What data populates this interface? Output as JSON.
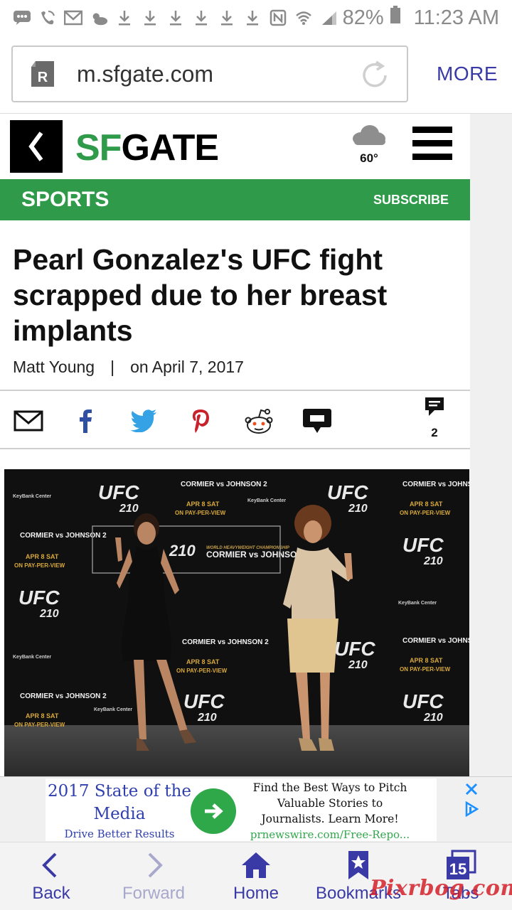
{
  "status_bar": {
    "battery": "82%",
    "time": "11:23 AM"
  },
  "browser": {
    "url": "m.sfgate.com",
    "more_label": "MORE"
  },
  "site": {
    "logo_sf": "SF",
    "logo_gate": "GATE",
    "weather_temp": "60°",
    "section": "SPORTS",
    "subscribe": "SUBSCRIBE",
    "brand_color": "#2f9a49"
  },
  "article": {
    "headline": "Pearl Gonzalez's UFC fight scrapped due to her breast implants",
    "author": "Matt Young",
    "separator": "|",
    "date": "on April 7, 2017",
    "comment_count": "2"
  },
  "share_icons": [
    "email-icon",
    "facebook-icon",
    "twitter-icon",
    "pinterest-icon",
    "reddit-icon",
    "comment-bubble-icon"
  ],
  "photo": {
    "banner_ufc": "UFC",
    "banner_number": "210",
    "banner_names": "CORMIER vs JOHNSON 2",
    "banner_date": "APR 8 SAT",
    "banner_ppv": "ON PAY-PER-VIEW",
    "banner_sponsor": "KeyBank Center",
    "banner_title": "WORLD HEAVYWEIGHT CHAMPIONSHIP"
  },
  "ad": {
    "left_title": "2017 State of the Media",
    "left_sub": "Drive Better Results",
    "right_text": "Find the Best Ways to Pitch Valuable Stories to Journalists. Learn More!",
    "right_url": "prnewswire.com/Free-Repo..."
  },
  "bottom_nav": {
    "back": "Back",
    "forward": "Forward",
    "home": "Home",
    "bookmarks": "Bookmarks",
    "tabs": "Tabs",
    "tab_count": "15"
  },
  "watermark": "Pixrbog.com",
  "colors": {
    "nav_blue": "#3a3aa6",
    "accent_green": "#2f9a49"
  }
}
